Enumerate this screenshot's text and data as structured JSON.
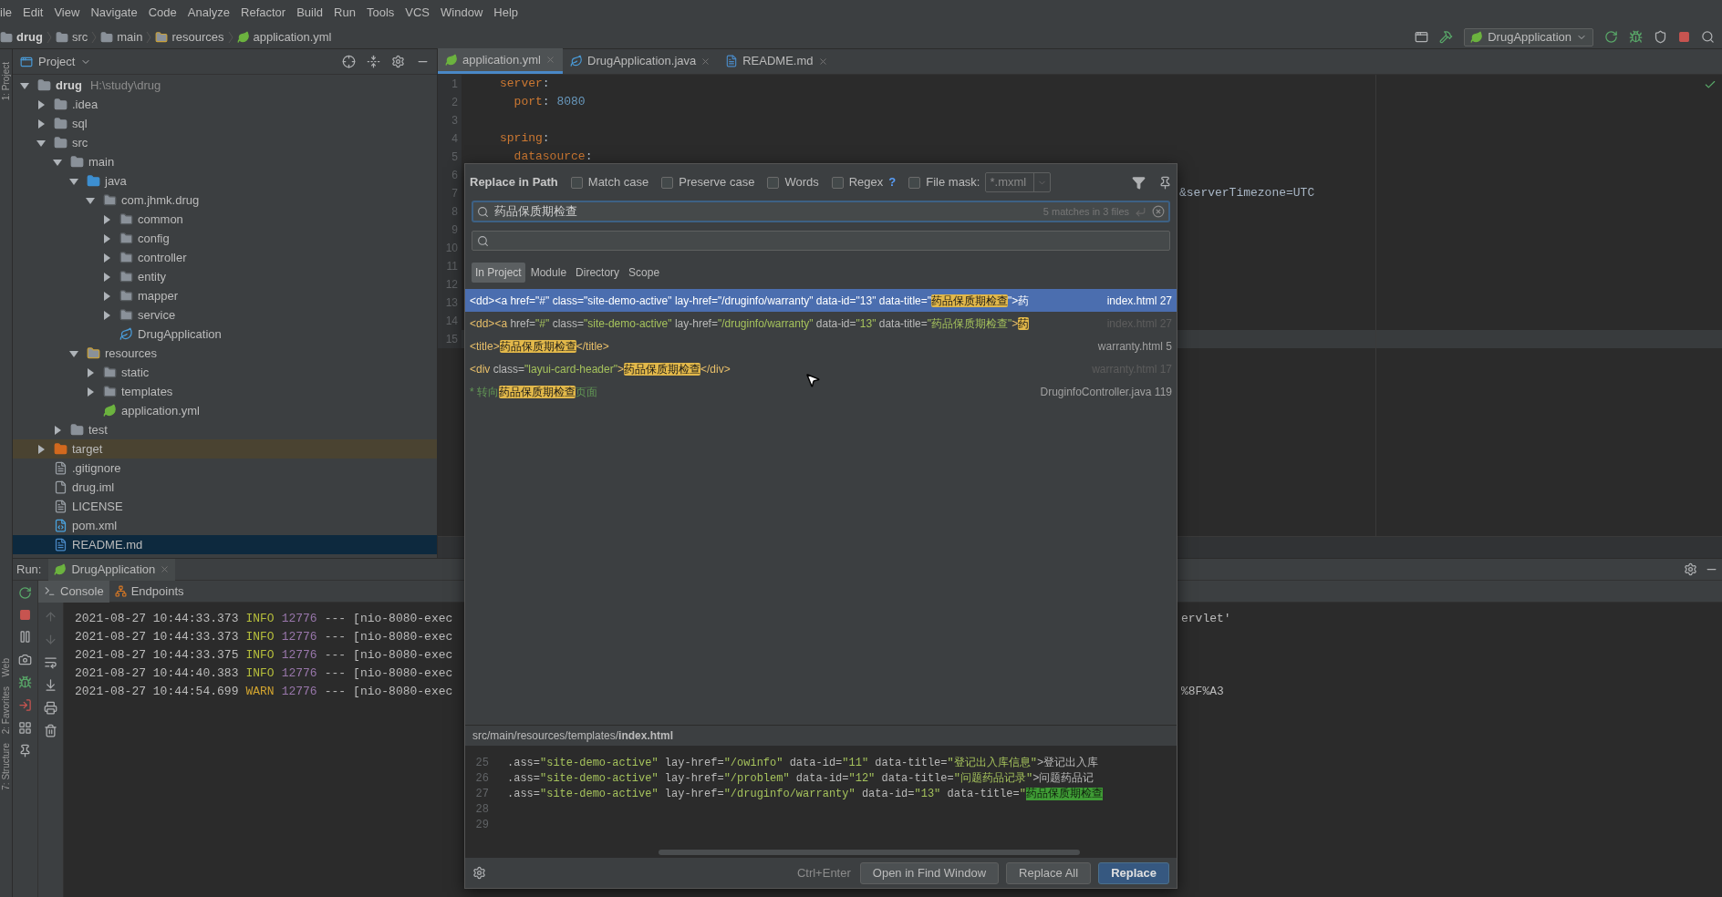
{
  "menu": [
    "ile",
    "Edit",
    "View",
    "Navigate",
    "Code",
    "Analyze",
    "Refactor",
    "Build",
    "Run",
    "Tools",
    "VCS",
    "Window",
    "Help"
  ],
  "breadcrumbs": [
    {
      "label": "drug",
      "kind": "module"
    },
    {
      "label": "src",
      "kind": "folder"
    },
    {
      "label": "main",
      "kind": "folder"
    },
    {
      "label": "resources",
      "kind": "resources"
    },
    {
      "label": "application.yml",
      "kind": "yml"
    }
  ],
  "run_config": "DrugApplication",
  "side_labels": [
    "1: Project",
    "Web",
    "2: Favorites",
    "7: Structure"
  ],
  "project": {
    "title": "Project",
    "tree": [
      {
        "name": "drug",
        "hint": "H:\\study\\drug",
        "kind": "module",
        "expanded": true,
        "selected": false,
        "children": [
          {
            "name": ".idea",
            "kind": "folder",
            "expanded": false,
            "selected": false
          },
          {
            "name": "sql",
            "kind": "folder",
            "expanded": false,
            "selected": false
          },
          {
            "name": "src",
            "kind": "folder",
            "expanded": true,
            "selected": false,
            "children": [
              {
                "name": "main",
                "kind": "folder",
                "expanded": true,
                "selected": false,
                "children": [
                  {
                    "name": "java",
                    "kind": "source",
                    "expanded": true,
                    "selected": false,
                    "children": [
                      {
                        "name": "com.jhmk.drug",
                        "kind": "package",
                        "expanded": true,
                        "selected": false,
                        "children": [
                          {
                            "name": "common",
                            "kind": "package",
                            "expanded": false,
                            "selected": false
                          },
                          {
                            "name": "config",
                            "kind": "package",
                            "expanded": false,
                            "selected": false
                          },
                          {
                            "name": "controller",
                            "kind": "package",
                            "expanded": false,
                            "selected": false
                          },
                          {
                            "name": "entity",
                            "kind": "package",
                            "expanded": false,
                            "selected": false
                          },
                          {
                            "name": "mapper",
                            "kind": "package",
                            "expanded": false,
                            "selected": false
                          },
                          {
                            "name": "service",
                            "kind": "package",
                            "expanded": false,
                            "selected": false
                          },
                          {
                            "name": "DrugApplication",
                            "kind": "spring_class",
                            "selected": false
                          }
                        ]
                      }
                    ]
                  },
                  {
                    "name": "resources",
                    "kind": "resources",
                    "expanded": true,
                    "selected": false,
                    "children": [
                      {
                        "name": "static",
                        "kind": "package",
                        "expanded": false,
                        "selected": false
                      },
                      {
                        "name": "templates",
                        "kind": "package",
                        "expanded": false,
                        "selected": false
                      },
                      {
                        "name": "application.yml",
                        "kind": "yml",
                        "selected": false
                      }
                    ]
                  }
                ]
              },
              {
                "name": "test",
                "kind": "folder",
                "expanded": false,
                "selected": false
              }
            ]
          },
          {
            "name": "target",
            "kind": "excluded",
            "expanded": false,
            "selected": false
          },
          {
            "name": ".gitignore",
            "kind": "text",
            "selected": false
          },
          {
            "name": "drug.iml",
            "kind": "iml",
            "selected": false
          },
          {
            "name": "LICENSE",
            "kind": "text",
            "selected": false
          },
          {
            "name": "pom.xml",
            "kind": "maven",
            "selected": false
          },
          {
            "name": "README.md",
            "kind": "markdown",
            "selected": true
          }
        ]
      }
    ]
  },
  "editor_tabs": [
    {
      "label": "application.yml",
      "kind": "yml",
      "selected": true
    },
    {
      "label": "DrugApplication.java",
      "kind": "spring_class",
      "selected": false
    },
    {
      "label": "README.md",
      "kind": "markdown",
      "selected": false
    }
  ],
  "editor_lines": [
    {
      "number": "1",
      "segments": [
        {
          "text": "server",
          "kind": "key"
        },
        {
          "text": ":",
          "kind": "plain"
        }
      ]
    },
    {
      "number": "2",
      "segments": [
        {
          "text": "  port",
          "kind": "key"
        },
        {
          "text": ": ",
          "kind": "plain"
        },
        {
          "text": "8080",
          "kind": "number"
        }
      ]
    },
    {
      "number": "3"
    },
    {
      "number": "4",
      "segments": [
        {
          "text": "spring",
          "kind": "key"
        },
        {
          "text": ":",
          "kind": "plain"
        }
      ]
    },
    {
      "number": "5",
      "segments": [
        {
          "text": "  datasource",
          "kind": "key"
        },
        {
          "text": ":",
          "kind": "plain"
        }
      ]
    },
    {
      "number": "6"
    },
    {
      "number": "7",
      "clipped": true,
      "segments": [
        {
          "text": "&serverTimezone=UTC",
          "kind": "plain"
        }
      ]
    },
    {
      "number": "8"
    },
    {
      "number": "9"
    },
    {
      "number": "10"
    },
    {
      "number": "11"
    },
    {
      "number": "12"
    },
    {
      "number": "13"
    },
    {
      "number": "14"
    },
    {
      "number": "15",
      "current": true
    }
  ],
  "dialog": {
    "title": "Replace in Path",
    "options": [
      {
        "label": "Match case",
        "checked": false
      },
      {
        "label": "Preserve case",
        "checked": false
      },
      {
        "label": "Words",
        "checked": false
      },
      {
        "label": "Regex",
        "checked": false,
        "help": "?"
      },
      {
        "label": "File mask:",
        "checked": false
      }
    ],
    "file_mask": {
      "value": "*.mxml",
      "disabled": true
    },
    "search": {
      "value": "药品保质期检查",
      "info": "5 matches in 3 files"
    },
    "scopes": [
      {
        "label": "In Project",
        "selected": true
      },
      {
        "label": "Module",
        "selected": false
      },
      {
        "label": "Directory",
        "selected": false
      },
      {
        "label": "Scope",
        "selected": false
      }
    ],
    "results": [
      {
        "selected": true,
        "file": "index.html 27",
        "segments": [
          {
            "text": "<dd>",
            "kind": "tag"
          },
          {
            "text": "<a",
            "kind": "tag"
          },
          {
            "text": " href=",
            "kind": "attr"
          },
          {
            "text": "\"#\"",
            "kind": "string"
          },
          {
            "text": " class=",
            "kind": "attr"
          },
          {
            "text": "\"site-demo-active\"",
            "kind": "string"
          },
          {
            "text": " lay-href=",
            "kind": "attr"
          },
          {
            "text": "\"/druginfo/warranty\"",
            "kind": "string"
          },
          {
            "text": " data-id=",
            "kind": "attr"
          },
          {
            "text": "\"13\"",
            "kind": "string"
          },
          {
            "text": " data-title=",
            "kind": "attr"
          },
          {
            "text": "\"",
            "kind": "string"
          },
          {
            "text": "药品保质期检查",
            "kind": "match"
          },
          {
            "text": "\"",
            "kind": "string"
          },
          {
            "text": ">药",
            "kind": "tag"
          }
        ]
      },
      {
        "selected": false,
        "dimmed": true,
        "file": "index.html 27",
        "segments": [
          {
            "text": "<dd>",
            "kind": "tag"
          },
          {
            "text": "<a",
            "kind": "tag"
          },
          {
            "text": " href=",
            "kind": "attr"
          },
          {
            "text": "\"#\"",
            "kind": "string"
          },
          {
            "text": " class=",
            "kind": "attr"
          },
          {
            "text": "\"site-demo-active\"",
            "kind": "string"
          },
          {
            "text": " lay-href=",
            "kind": "attr"
          },
          {
            "text": "\"/druginfo/warranty\"",
            "kind": "string"
          },
          {
            "text": " data-id=",
            "kind": "attr"
          },
          {
            "text": "\"13\"",
            "kind": "string"
          },
          {
            "text": " data-title=",
            "kind": "attr"
          },
          {
            "text": "\"药品保质期检查\"",
            "kind": "string"
          },
          {
            "text": ">",
            "kind": "tag"
          },
          {
            "text": "药",
            "kind": "match"
          }
        ]
      },
      {
        "selected": false,
        "file": "warranty.html 5",
        "segments": [
          {
            "text": "<title>",
            "kind": "tag"
          },
          {
            "text": "药品保质期检查",
            "kind": "match"
          },
          {
            "text": "</title>",
            "kind": "tag"
          }
        ]
      },
      {
        "selected": false,
        "dimmed": true,
        "file": "warranty.html 17",
        "segments": [
          {
            "text": "<div",
            "kind": "tag"
          },
          {
            "text": " class=",
            "kind": "attr"
          },
          {
            "text": "\"layui-card-header\"",
            "kind": "string"
          },
          {
            "text": ">",
            "kind": "tag"
          },
          {
            "text": "药品保质期检查",
            "kind": "match"
          },
          {
            "text": "</div>",
            "kind": "tag"
          }
        ]
      },
      {
        "selected": false,
        "file": "DruginfoController.java 119",
        "segments": [
          {
            "text": "* 转向",
            "kind": "comment"
          },
          {
            "text": "药品保质期检查",
            "kind": "match"
          },
          {
            "text": "页面",
            "kind": "comment"
          }
        ]
      }
    ],
    "preview": {
      "path": "src/main/resources/templates/",
      "file": "index.html",
      "lines": [
        {
          "number": "25",
          "segments": [
            {
              "text": ".ass=",
              "kind": "attr"
            },
            {
              "text": "\"site-demo-active\"",
              "kind": "string"
            },
            {
              "text": " lay-href=",
              "kind": "attr"
            },
            {
              "text": "\"/owinfo\"",
              "kind": "string"
            },
            {
              "text": " data-id=",
              "kind": "attr"
            },
            {
              "text": "\"11\"",
              "kind": "string"
            },
            {
              "text": " data-title=",
              "kind": "attr"
            },
            {
              "text": "\"登记出入库信息\"",
              "kind": "string"
            },
            {
              "text": ">登记出入库",
              "kind": "attr"
            }
          ]
        },
        {
          "number": "26",
          "segments": [
            {
              "text": ".ass=",
              "kind": "attr"
            },
            {
              "text": "\"site-demo-active\"",
              "kind": "string"
            },
            {
              "text": " lay-href=",
              "kind": "attr"
            },
            {
              "text": "\"/problem\"",
              "kind": "string"
            },
            {
              "text": " data-id=",
              "kind": "attr"
            },
            {
              "text": "\"12\"",
              "kind": "string"
            },
            {
              "text": " data-title=",
              "kind": "attr"
            },
            {
              "text": "\"问题药品记录\"",
              "kind": "string"
            },
            {
              "text": ">问题药品记",
              "kind": "attr"
            }
          ]
        },
        {
          "number": "27",
          "segments": [
            {
              "text": ".ass=",
              "kind": "attr"
            },
            {
              "text": "\"site-demo-active\"",
              "kind": "string"
            },
            {
              "text": " lay-href=",
              "kind": "attr"
            },
            {
              "text": "\"/druginfo/warranty\"",
              "kind": "string"
            },
            {
              "text": " data-id=",
              "kind": "attr"
            },
            {
              "text": "\"13\"",
              "kind": "string"
            },
            {
              "text": " data-title=",
              "kind": "attr"
            },
            {
              "text": "\"",
              "kind": "string"
            },
            {
              "text": "药品保质期检查",
              "kind": "match"
            }
          ]
        },
        {
          "number": "28"
        },
        {
          "number": "29"
        }
      ]
    },
    "shortcut": "Ctrl+Enter",
    "buttons": [
      {
        "label": "Open in Find Window",
        "kind": "normal"
      },
      {
        "label": "Replace All",
        "kind": "normal"
      },
      {
        "label": "Replace",
        "kind": "primary"
      }
    ]
  },
  "run": {
    "label": "Run:",
    "tab": "DrugApplication",
    "tabs": [
      {
        "label": "Console",
        "kind": "console",
        "selected": true
      },
      {
        "label": "Endpoints",
        "kind": "endpoints",
        "selected": false
      }
    ],
    "lines": [
      {
        "time": "2021-08-27 10:44:33.373",
        "level": "INFO",
        "kind": "info",
        "pid": "12776",
        "sep": "---",
        "thread": "[nio-8080-exec",
        "tail": "ervlet'"
      },
      {
        "time": "2021-08-27 10:44:33.373",
        "level": "INFO",
        "kind": "info",
        "pid": "12776",
        "sep": "---",
        "thread": "[nio-8080-exec"
      },
      {
        "time": "2021-08-27 10:44:33.375",
        "level": "INFO",
        "kind": "info",
        "pid": "12776",
        "sep": "---",
        "thread": "[nio-8080-exec"
      },
      {
        "time": "2021-08-27 10:44:40.383",
        "level": "INFO",
        "kind": "info",
        "pid": "12776",
        "sep": "---",
        "thread": "[nio-8080-exec"
      },
      {
        "time": "2021-08-27 10:44:54.699",
        "level": "WARN",
        "kind": "warn",
        "pid": "12776",
        "sep": "---",
        "thread": "[nio-8080-exec",
        "tail": "%8F%A3"
      }
    ]
  }
}
